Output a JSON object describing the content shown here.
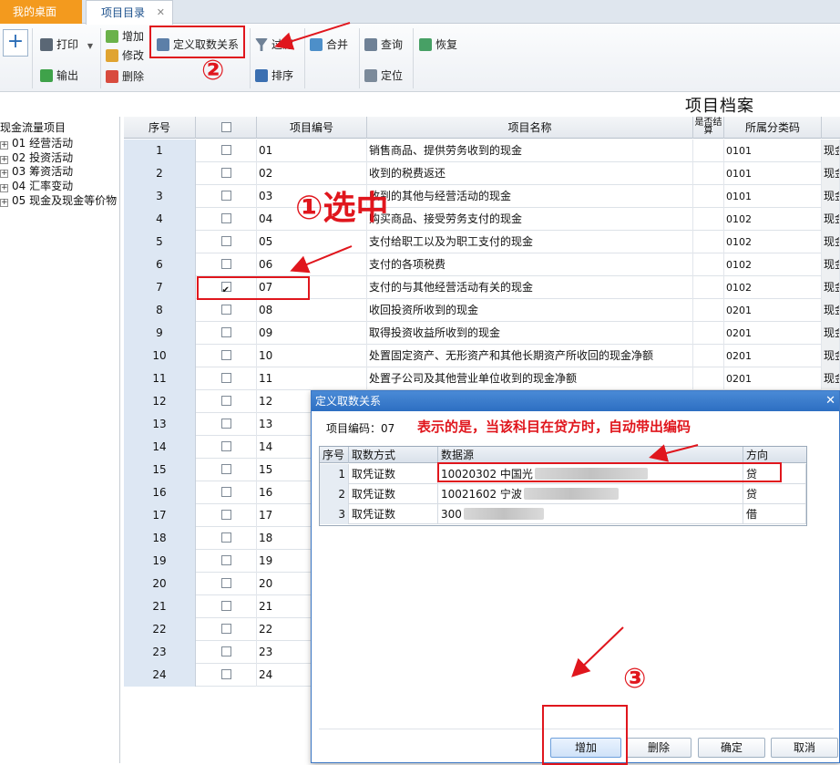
{
  "tabs": [
    {
      "label": "我的桌面"
    },
    {
      "label": "项目目录",
      "close": "✕"
    }
  ],
  "toolbar": {
    "print": "打印",
    "export": "输出",
    "add": "增加",
    "modify": "修改",
    "delete": "删除",
    "define_relation": "定义取数关系",
    "filter": "过滤",
    "sort": "排序",
    "merge": "合并",
    "query": "查询",
    "locate": "定位",
    "restore": "恢复"
  },
  "page_title": "项目档案",
  "tree": {
    "root": "现金流量项目",
    "nodes": [
      "01 经营活动",
      "02 投资活动",
      "03 筹资活动",
      "04 汇率变动",
      "05 现金及现金等价物"
    ]
  },
  "grid": {
    "headers": {
      "seq": "序号",
      "code": "项目编号",
      "name": "项目名称",
      "settle": "是否结算",
      "category": "所属分类码"
    },
    "rows": [
      {
        "seq": "1",
        "code": "01",
        "name": "销售商品、提供劳务收到的现金",
        "cat": "0101",
        "more": "现金"
      },
      {
        "seq": "2",
        "code": "02",
        "name": "收到的税费返还",
        "cat": "0101",
        "more": "现金"
      },
      {
        "seq": "3",
        "code": "03",
        "name": "收到的其他与经营活动的现金",
        "cat": "0101",
        "more": "现金"
      },
      {
        "seq": "4",
        "code": "04",
        "name": "购买商品、接受劳务支付的现金",
        "cat": "0102",
        "more": "现金"
      },
      {
        "seq": "5",
        "code": "05",
        "name": "支付给职工以及为职工支付的现金",
        "cat": "0102",
        "more": "现金"
      },
      {
        "seq": "6",
        "code": "06",
        "name": "支付的各项税费",
        "cat": "0102",
        "more": "现金"
      },
      {
        "seq": "7",
        "code": "07",
        "name": "支付的与其他经营活动有关的现金",
        "cat": "0102",
        "more": "现金",
        "checked": true
      },
      {
        "seq": "8",
        "code": "08",
        "name": "收回投资所收到的现金",
        "cat": "0201",
        "more": "现金"
      },
      {
        "seq": "9",
        "code": "09",
        "name": "取得投资收益所收到的现金",
        "cat": "0201",
        "more": "现金"
      },
      {
        "seq": "10",
        "code": "10",
        "name": "处置固定资产、无形资产和其他长期资产所收回的现金净额",
        "cat": "0201",
        "more": "现金"
      },
      {
        "seq": "11",
        "code": "11",
        "name": "处置子公司及其他营业单位收到的现金净额",
        "cat": "0201",
        "more": "现金"
      },
      {
        "seq": "12",
        "code": "12",
        "name": "",
        "cat": "",
        "more": ""
      },
      {
        "seq": "13",
        "code": "13",
        "name": "",
        "cat": "",
        "more": ""
      },
      {
        "seq": "14",
        "code": "14",
        "name": "",
        "cat": "",
        "more": ""
      },
      {
        "seq": "15",
        "code": "15",
        "name": "",
        "cat": "",
        "more": ""
      },
      {
        "seq": "16",
        "code": "16",
        "name": "",
        "cat": "",
        "more": ""
      },
      {
        "seq": "17",
        "code": "17",
        "name": "",
        "cat": "",
        "more": ""
      },
      {
        "seq": "18",
        "code": "18",
        "name": "",
        "cat": "",
        "more": ""
      },
      {
        "seq": "19",
        "code": "19",
        "name": "",
        "cat": "",
        "more": ""
      },
      {
        "seq": "20",
        "code": "20",
        "name": "",
        "cat": "",
        "more": ""
      },
      {
        "seq": "21",
        "code": "21",
        "name": "",
        "cat": "",
        "more": ""
      },
      {
        "seq": "22",
        "code": "22",
        "name": "",
        "cat": "",
        "more": ""
      },
      {
        "seq": "23",
        "code": "23",
        "name": "",
        "cat": "",
        "more": ""
      },
      {
        "seq": "24",
        "code": "24",
        "name": "",
        "cat": "",
        "more": ""
      }
    ]
  },
  "dialog": {
    "title": "定义取数关系",
    "close": "✕",
    "code_label": "项目编码：07",
    "note": "表示的是，当该科目在贷方时，自动带出编码",
    "headers": {
      "no": "序号",
      "way": "取数方式",
      "source": "数据源",
      "direction": "方向"
    },
    "rows": [
      {
        "no": "1",
        "way": "取凭证数",
        "source": "10020302 中国光",
        "direction": "贷"
      },
      {
        "no": "2",
        "way": "取凭证数",
        "source": "10021602 宁波",
        "direction": "贷"
      },
      {
        "no": "3",
        "way": "取凭证数",
        "source": "300",
        "direction": "借"
      }
    ],
    "buttons": {
      "add": "增加",
      "delete": "删除",
      "ok": "确定",
      "cancel": "取消"
    }
  },
  "annotations": {
    "step1_num": "①",
    "step1_text": "选中",
    "step2_num": "②",
    "step3_num": "③"
  }
}
